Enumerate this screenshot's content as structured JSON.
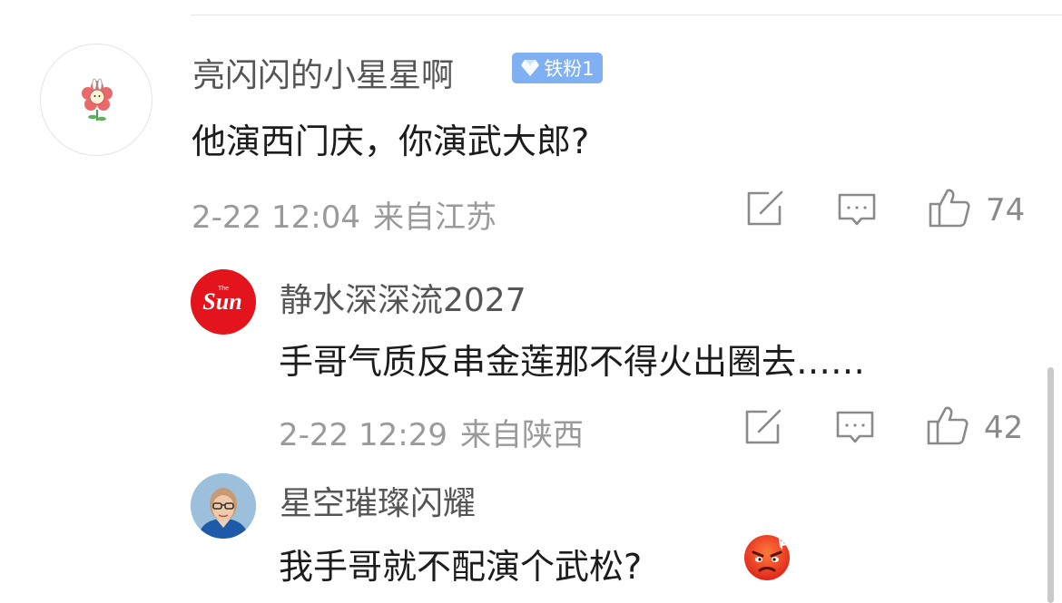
{
  "comment": {
    "username": "亮闪闪的小星星啊",
    "badge": "铁粉1",
    "text": "他演西门庆，你演武大郎?",
    "date": "2-22 12:04",
    "location": "来自江苏",
    "likes": "74",
    "avatar_icon": "flower-icon"
  },
  "replies": [
    {
      "username": "静水深深流2027",
      "text": "手哥气质反串金莲那不得火出圈去……",
      "date": "2-22 12:29",
      "location": "来自陕西",
      "likes": "42",
      "avatar_icon": "sun-logo-icon",
      "avatar_text": "Sun",
      "avatar_small": "The"
    },
    {
      "username": "星空璀璨闪耀",
      "text": "我手哥就不配演个武松?",
      "avatar_icon": "portrait-avatar-icon",
      "emoji_icon": "angry-face-emoji-icon"
    }
  ],
  "colors": {
    "badge": "#7fb1f2",
    "sun_red": "#e3141c",
    "meta_gray": "#9a9a9a"
  }
}
